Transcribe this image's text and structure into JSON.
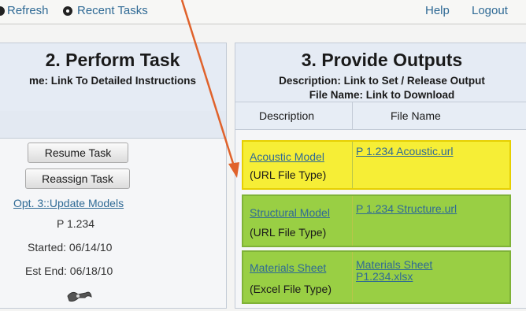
{
  "toolbar": {
    "refresh_label": "Refresh",
    "recent_label": "Recent Tasks",
    "help_label": "Help",
    "logout_label": "Logout"
  },
  "perform": {
    "title": "2. Perform Task",
    "subtitle": "me: Link To Detailed Instructions",
    "resume_label": "Resume Task",
    "reassign_label": "Reassign Task",
    "option_link": "Opt. 3::Update Models",
    "task_id": "P 1.234",
    "started": "Started: 06/14/10",
    "est_end": "Est End: 06/18/10"
  },
  "outputs": {
    "title": "3. Provide Outputs",
    "subtitle_line1": "Description: Link to Set / Release Output",
    "subtitle_line2": "File Name: Link to Download",
    "col_description": "Description",
    "col_filename": "File Name",
    "rows": [
      {
        "description": "Acoustic Model",
        "type": "(URL File Type)",
        "file": "P 1.234 Acoustic.url",
        "color": "#f6ee36"
      },
      {
        "description": "Structural Model",
        "type": "(URL File Type)",
        "file": "P 1.234 Structure.url",
        "color": "#99cf44"
      },
      {
        "description": "Materials Sheet",
        "type": "(Excel File Type)",
        "file": "Materials Sheet P1.234.xlsx",
        "color": "#99cf44"
      }
    ]
  },
  "colors": {
    "link": "#2f6a95",
    "arrow": "#e0622b",
    "highlight_yellow": "#f6ee36",
    "highlight_green": "#99cf44"
  },
  "icons": [
    "refresh-bullet-icon",
    "recent-tasks-radio-icon",
    "tool-icon",
    "pointer-arrow-icon"
  ]
}
